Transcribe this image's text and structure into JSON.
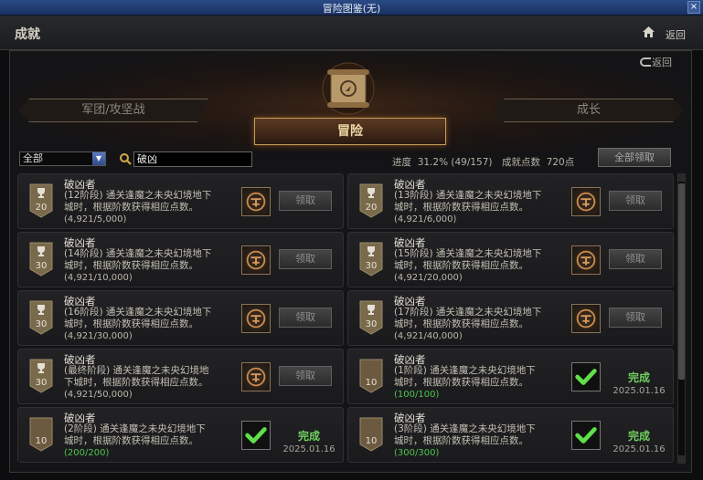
{
  "window": {
    "title": "冒险图鉴(无)",
    "close": "×"
  },
  "header": {
    "title": "成就",
    "back": "返回"
  },
  "sub_back": "返回",
  "tabs": {
    "left": "军团/攻坚战",
    "center": "冒险",
    "right": "成长"
  },
  "filter": {
    "value": "全部"
  },
  "search": {
    "value": "破凶"
  },
  "progress": {
    "label": "进度",
    "value": "31.2% (49/157)"
  },
  "points": {
    "label": "成就点数",
    "value": "720点"
  },
  "claim_all": "全部领取",
  "cards": [
    {
      "title": "破凶者",
      "level": "20",
      "desc1": "(12阶段) 通关逢魔之未央幻境地下",
      "desc2": "城时，根据阶数获得相应点数。",
      "progress": "(4,921/5,000)",
      "done": false,
      "button": "领取"
    },
    {
      "title": "破凶者",
      "level": "20",
      "desc1": "(13阶段) 通关逢魔之未央幻境地下",
      "desc2": "城时，根据阶数获得相应点数。",
      "progress": "(4,921/6,000)",
      "done": false,
      "button": "领取"
    },
    {
      "title": "破凶者",
      "level": "30",
      "desc1": "(14阶段) 通关逢魔之未央幻境地下",
      "desc2": "城时，根据阶数获得相应点数。",
      "progress": "(4,921/10,000)",
      "done": false,
      "button": "领取"
    },
    {
      "title": "破凶者",
      "level": "30",
      "desc1": "(15阶段) 通关逢魔之未央幻境地下",
      "desc2": "城时，根据阶数获得相应点数。",
      "progress": "(4,921/20,000)",
      "done": false,
      "button": "领取"
    },
    {
      "title": "破凶者",
      "level": "30",
      "desc1": "(16阶段) 通关逢魔之未央幻境地下",
      "desc2": "城时，根据阶数获得相应点数。",
      "progress": "(4,921/30,000)",
      "done": false,
      "button": "领取"
    },
    {
      "title": "破凶者",
      "level": "30",
      "desc1": "(17阶段) 通关逢魔之未央幻境地下",
      "desc2": "城时，根据阶数获得相应点数。",
      "progress": "(4,921/40,000)",
      "done": false,
      "button": "领取"
    },
    {
      "title": "破凶者",
      "level": "30",
      "desc1": "(最终阶段) 通关逢魔之未央幻境地",
      "desc2": "下城时，根据阶数获得相应点数。",
      "progress": "(4,921/50,000)",
      "done": false,
      "button": "领取"
    },
    {
      "title": "破凶者",
      "level": "10",
      "desc1": "(1阶段) 通关逢魔之未央幻境地下",
      "desc2": "城时，根据阶数获得相应点数。",
      "progress": "(100/100)",
      "done": true,
      "done_label": "完成",
      "date": "2025.01.16"
    },
    {
      "title": "破凶者",
      "level": "10",
      "desc1": "(2阶段) 通关逢魔之未央幻境地下",
      "desc2": "城时，根据阶数获得相应点数。",
      "progress": "(200/200)",
      "done": true,
      "done_label": "完成",
      "date": "2025.01.16"
    },
    {
      "title": "破凶者",
      "level": "10",
      "desc1": "(3阶段) 通关逢魔之未央幻境地下",
      "desc2": "城时，根据阶数获得相应点数。",
      "progress": "(300/300)",
      "done": true,
      "done_label": "完成",
      "date": "2025.01.16"
    }
  ]
}
